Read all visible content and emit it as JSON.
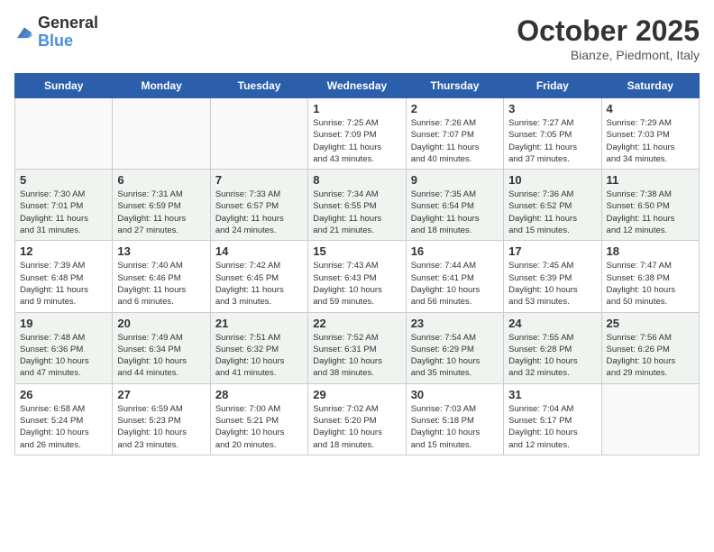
{
  "header": {
    "logo_line1": "General",
    "logo_line2": "Blue",
    "month_title": "October 2025",
    "location": "Bianze, Piedmont, Italy"
  },
  "weekdays": [
    "Sunday",
    "Monday",
    "Tuesday",
    "Wednesday",
    "Thursday",
    "Friday",
    "Saturday"
  ],
  "weeks": [
    [
      {
        "day": "",
        "info": ""
      },
      {
        "day": "",
        "info": ""
      },
      {
        "day": "",
        "info": ""
      },
      {
        "day": "1",
        "info": "Sunrise: 7:25 AM\nSunset: 7:09 PM\nDaylight: 11 hours\nand 43 minutes."
      },
      {
        "day": "2",
        "info": "Sunrise: 7:26 AM\nSunset: 7:07 PM\nDaylight: 11 hours\nand 40 minutes."
      },
      {
        "day": "3",
        "info": "Sunrise: 7:27 AM\nSunset: 7:05 PM\nDaylight: 11 hours\nand 37 minutes."
      },
      {
        "day": "4",
        "info": "Sunrise: 7:29 AM\nSunset: 7:03 PM\nDaylight: 11 hours\nand 34 minutes."
      }
    ],
    [
      {
        "day": "5",
        "info": "Sunrise: 7:30 AM\nSunset: 7:01 PM\nDaylight: 11 hours\nand 31 minutes."
      },
      {
        "day": "6",
        "info": "Sunrise: 7:31 AM\nSunset: 6:59 PM\nDaylight: 11 hours\nand 27 minutes."
      },
      {
        "day": "7",
        "info": "Sunrise: 7:33 AM\nSunset: 6:57 PM\nDaylight: 11 hours\nand 24 minutes."
      },
      {
        "day": "8",
        "info": "Sunrise: 7:34 AM\nSunset: 6:55 PM\nDaylight: 11 hours\nand 21 minutes."
      },
      {
        "day": "9",
        "info": "Sunrise: 7:35 AM\nSunset: 6:54 PM\nDaylight: 11 hours\nand 18 minutes."
      },
      {
        "day": "10",
        "info": "Sunrise: 7:36 AM\nSunset: 6:52 PM\nDaylight: 11 hours\nand 15 minutes."
      },
      {
        "day": "11",
        "info": "Sunrise: 7:38 AM\nSunset: 6:50 PM\nDaylight: 11 hours\nand 12 minutes."
      }
    ],
    [
      {
        "day": "12",
        "info": "Sunrise: 7:39 AM\nSunset: 6:48 PM\nDaylight: 11 hours\nand 9 minutes."
      },
      {
        "day": "13",
        "info": "Sunrise: 7:40 AM\nSunset: 6:46 PM\nDaylight: 11 hours\nand 6 minutes."
      },
      {
        "day": "14",
        "info": "Sunrise: 7:42 AM\nSunset: 6:45 PM\nDaylight: 11 hours\nand 3 minutes."
      },
      {
        "day": "15",
        "info": "Sunrise: 7:43 AM\nSunset: 6:43 PM\nDaylight: 10 hours\nand 59 minutes."
      },
      {
        "day": "16",
        "info": "Sunrise: 7:44 AM\nSunset: 6:41 PM\nDaylight: 10 hours\nand 56 minutes."
      },
      {
        "day": "17",
        "info": "Sunrise: 7:45 AM\nSunset: 6:39 PM\nDaylight: 10 hours\nand 53 minutes."
      },
      {
        "day": "18",
        "info": "Sunrise: 7:47 AM\nSunset: 6:38 PM\nDaylight: 10 hours\nand 50 minutes."
      }
    ],
    [
      {
        "day": "19",
        "info": "Sunrise: 7:48 AM\nSunset: 6:36 PM\nDaylight: 10 hours\nand 47 minutes."
      },
      {
        "day": "20",
        "info": "Sunrise: 7:49 AM\nSunset: 6:34 PM\nDaylight: 10 hours\nand 44 minutes."
      },
      {
        "day": "21",
        "info": "Sunrise: 7:51 AM\nSunset: 6:32 PM\nDaylight: 10 hours\nand 41 minutes."
      },
      {
        "day": "22",
        "info": "Sunrise: 7:52 AM\nSunset: 6:31 PM\nDaylight: 10 hours\nand 38 minutes."
      },
      {
        "day": "23",
        "info": "Sunrise: 7:54 AM\nSunset: 6:29 PM\nDaylight: 10 hours\nand 35 minutes."
      },
      {
        "day": "24",
        "info": "Sunrise: 7:55 AM\nSunset: 6:28 PM\nDaylight: 10 hours\nand 32 minutes."
      },
      {
        "day": "25",
        "info": "Sunrise: 7:56 AM\nSunset: 6:26 PM\nDaylight: 10 hours\nand 29 minutes."
      }
    ],
    [
      {
        "day": "26",
        "info": "Sunrise: 6:58 AM\nSunset: 5:24 PM\nDaylight: 10 hours\nand 26 minutes."
      },
      {
        "day": "27",
        "info": "Sunrise: 6:59 AM\nSunset: 5:23 PM\nDaylight: 10 hours\nand 23 minutes."
      },
      {
        "day": "28",
        "info": "Sunrise: 7:00 AM\nSunset: 5:21 PM\nDaylight: 10 hours\nand 20 minutes."
      },
      {
        "day": "29",
        "info": "Sunrise: 7:02 AM\nSunset: 5:20 PM\nDaylight: 10 hours\nand 18 minutes."
      },
      {
        "day": "30",
        "info": "Sunrise: 7:03 AM\nSunset: 5:18 PM\nDaylight: 10 hours\nand 15 minutes."
      },
      {
        "day": "31",
        "info": "Sunrise: 7:04 AM\nSunset: 5:17 PM\nDaylight: 10 hours\nand 12 minutes."
      },
      {
        "day": "",
        "info": ""
      }
    ]
  ]
}
